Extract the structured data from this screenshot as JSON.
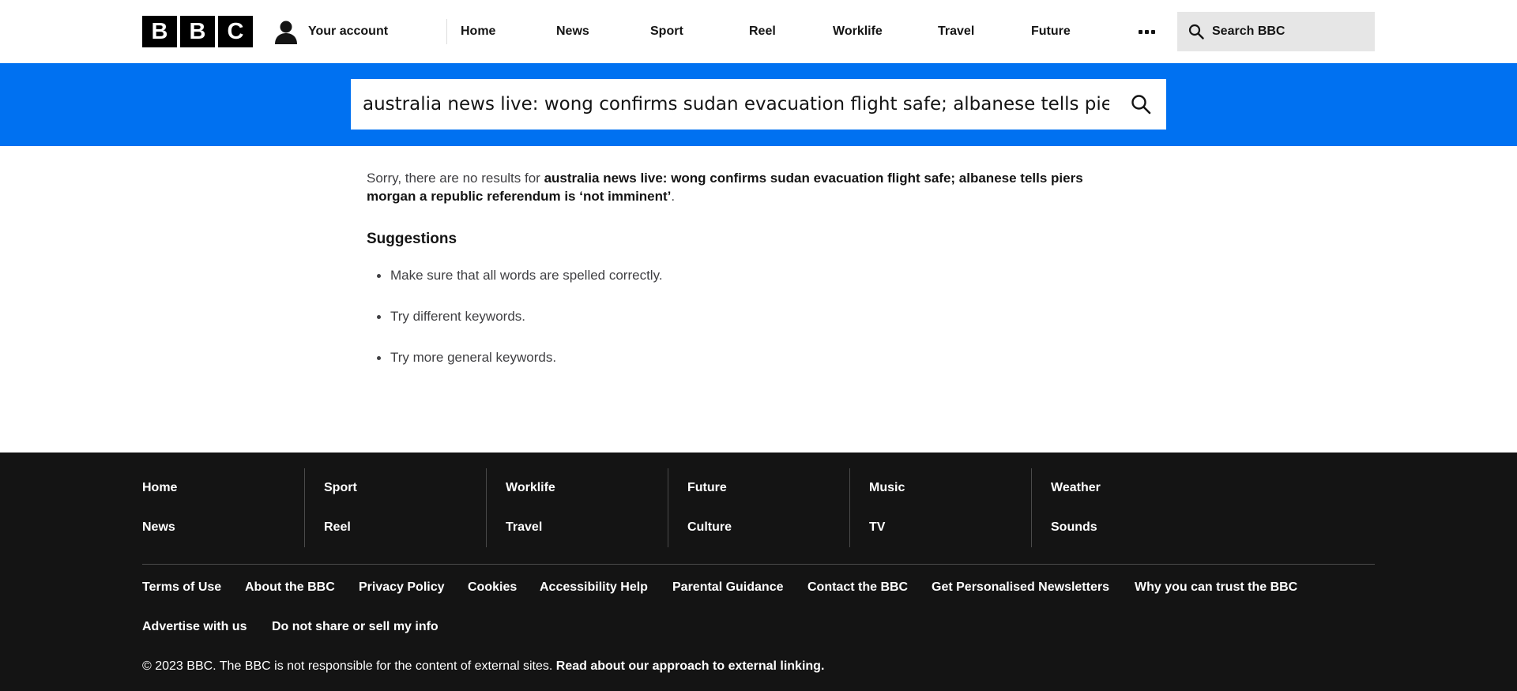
{
  "header": {
    "logo_letters": [
      "B",
      "B",
      "C"
    ],
    "account_label": "Your account",
    "nav": [
      "Home",
      "News",
      "Sport",
      "Reel",
      "Worklife",
      "Travel",
      "Future"
    ],
    "search_label": "Search BBC"
  },
  "search": {
    "value": "australia news live: wong confirms sudan evacuation flight safe; albanese tells piers morgan a republic referendum is ‘not imminent’"
  },
  "main": {
    "sorry_prefix": "Sorry, there are no results for ",
    "query_bold": "australia news live: wong confirms sudan evacuation flight safe; albanese tells piers morgan a republic referendum is ‘not imminent’",
    "sorry_suffix": ".",
    "suggestions_title": "Suggestions",
    "suggestions": [
      "Make sure that all words are spelled correctly.",
      "Try different keywords.",
      "Try more general keywords."
    ]
  },
  "footer": {
    "columns": [
      [
        "Home",
        "News"
      ],
      [
        "Sport",
        "Reel"
      ],
      [
        "Worklife",
        "Travel"
      ],
      [
        "Future",
        "Culture"
      ],
      [
        "Music",
        "TV"
      ],
      [
        "Weather",
        "Sounds"
      ]
    ],
    "links": [
      "Terms of Use",
      "About the BBC",
      "Privacy Policy",
      "Cookies",
      "Accessibility Help",
      "Parental Guidance",
      "Contact the BBC",
      "Get Personalised Newsletters",
      "Why you can trust the BBC",
      "Advertise with us",
      "Do not share or sell my info"
    ],
    "copyright": "© 2023 BBC. The BBC is not responsible for the content of external sites. ",
    "external_link": "Read about our approach to external linking."
  },
  "colors": {
    "brand_blue": "#0071f1",
    "footer_bg": "#141414"
  }
}
